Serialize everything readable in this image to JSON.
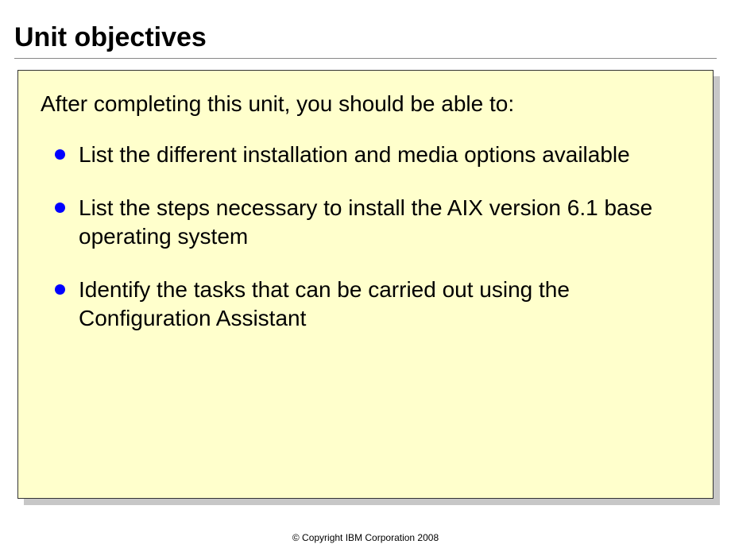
{
  "slide": {
    "title": "Unit objectives",
    "intro": "After completing this unit, you should be able to:",
    "bullets": [
      "List the different installation and media options available",
      "List the steps necessary to install the AIX version 6.1 base operating system",
      "Identify the tasks that can be carried out using the Configuration Assistant"
    ],
    "footer": "© Copyright IBM Corporation 2008"
  }
}
